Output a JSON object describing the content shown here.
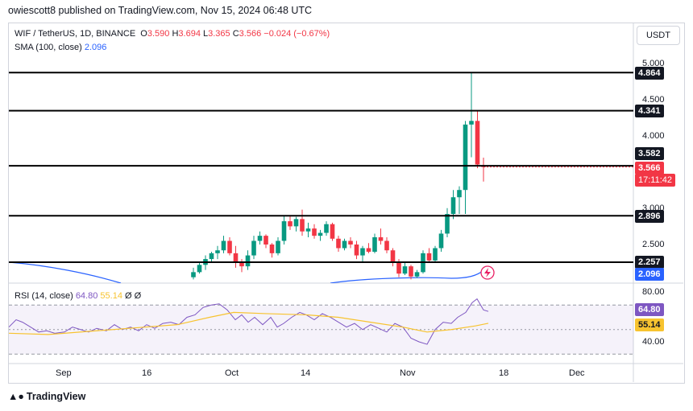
{
  "publisher": {
    "text": "owiescott8 published on TradingView.com, Nov 15, 2024 06:48 UTC"
  },
  "header": {
    "symbol": "WIF / TetherUS, 1D, BINANCE",
    "o_label": "O",
    "o_value": "3.590",
    "h_label": "H",
    "h_value": "3.694",
    "l_label": "L",
    "l_value": "3.365",
    "c_label": "C",
    "c_value": "3.566",
    "change": "−0.024 (−0.67%)",
    "sma_label": "SMA (100, close)",
    "sma_value": "2.096",
    "currency_button": "USDT"
  },
  "price_axis": {
    "ticks": [
      "5.000",
      "4.500",
      "4.000",
      "3.000",
      "2.500"
    ],
    "tags": {
      "line1": "4.864",
      "line2": "4.341",
      "line3": "3.582",
      "last_price": "3.566",
      "countdown": "17:11:42",
      "line4": "2.896",
      "line5": "2.257",
      "sma": "2.096"
    }
  },
  "rsi": {
    "label": "RSI (14, close)",
    "value": "64.80",
    "ma_value": "55.14",
    "extra1": "Ø",
    "extra2": "Ø",
    "axis_ticks": [
      "80.00",
      "40.00"
    ],
    "tags": {
      "rsi": "64.80",
      "ma": "55.14"
    }
  },
  "time_axis": {
    "labels": [
      "Sep",
      "16",
      "Oct",
      "14",
      "Nov",
      "18",
      "Dec"
    ]
  },
  "footer": {
    "brand": "TradingView"
  },
  "colors": {
    "up": "#089981",
    "down": "#f23645",
    "sma": "#2962ff",
    "rsi": "#7e57c2",
    "rsi_ma": "#f7c32f",
    "level_line": "#000000"
  },
  "chart_data": {
    "type": "candlestick",
    "title": "WIF / TetherUS, 1D, BINANCE",
    "levels": [
      4.864,
      4.341,
      3.582,
      2.896,
      2.257
    ],
    "candles": [
      {
        "o": 2.05,
        "h": 2.18,
        "l": 2.02,
        "c": 2.12
      },
      {
        "o": 2.12,
        "h": 2.26,
        "l": 2.1,
        "c": 2.22
      },
      {
        "o": 2.22,
        "h": 2.35,
        "l": 2.15,
        "c": 2.3
      },
      {
        "o": 2.3,
        "h": 2.4,
        "l": 2.25,
        "c": 2.38
      },
      {
        "o": 2.38,
        "h": 2.48,
        "l": 2.3,
        "c": 2.42
      },
      {
        "o": 2.42,
        "h": 2.62,
        "l": 2.38,
        "c": 2.55
      },
      {
        "o": 2.55,
        "h": 2.6,
        "l": 2.35,
        "c": 2.38
      },
      {
        "o": 2.38,
        "h": 2.48,
        "l": 2.18,
        "c": 2.25
      },
      {
        "o": 2.25,
        "h": 2.3,
        "l": 2.12,
        "c": 2.2
      },
      {
        "o": 2.2,
        "h": 2.42,
        "l": 2.15,
        "c": 2.35
      },
      {
        "o": 2.35,
        "h": 2.62,
        "l": 2.3,
        "c": 2.55
      },
      {
        "o": 2.55,
        "h": 2.68,
        "l": 2.5,
        "c": 2.62
      },
      {
        "o": 2.62,
        "h": 2.64,
        "l": 2.45,
        "c": 2.5
      },
      {
        "o": 2.5,
        "h": 2.52,
        "l": 2.32,
        "c": 2.38
      },
      {
        "o": 2.38,
        "h": 2.6,
        "l": 2.35,
        "c": 2.55
      },
      {
        "o": 2.55,
        "h": 2.9,
        "l": 2.5,
        "c": 2.82
      },
      {
        "o": 2.82,
        "h": 2.9,
        "l": 2.7,
        "c": 2.75
      },
      {
        "o": 2.75,
        "h": 2.88,
        "l": 2.68,
        "c": 2.85
      },
      {
        "o": 2.85,
        "h": 2.98,
        "l": 2.62,
        "c": 2.68
      },
      {
        "o": 2.68,
        "h": 2.8,
        "l": 2.6,
        "c": 2.72
      },
      {
        "o": 2.72,
        "h": 2.78,
        "l": 2.58,
        "c": 2.62
      },
      {
        "o": 2.62,
        "h": 2.7,
        "l": 2.55,
        "c": 2.66
      },
      {
        "o": 2.66,
        "h": 2.82,
        "l": 2.62,
        "c": 2.78
      },
      {
        "o": 2.78,
        "h": 2.8,
        "l": 2.55,
        "c": 2.58
      },
      {
        "o": 2.58,
        "h": 2.62,
        "l": 2.4,
        "c": 2.45
      },
      {
        "o": 2.45,
        "h": 2.58,
        "l": 2.42,
        "c": 2.55
      },
      {
        "o": 2.55,
        "h": 2.6,
        "l": 2.45,
        "c": 2.5
      },
      {
        "o": 2.5,
        "h": 2.55,
        "l": 2.3,
        "c": 2.35
      },
      {
        "o": 2.35,
        "h": 2.48,
        "l": 2.25,
        "c": 2.45
      },
      {
        "o": 2.45,
        "h": 2.52,
        "l": 2.38,
        "c": 2.4
      },
      {
        "o": 2.4,
        "h": 2.65,
        "l": 2.38,
        "c": 2.6
      },
      {
        "o": 2.6,
        "h": 2.72,
        "l": 2.5,
        "c": 2.55
      },
      {
        "o": 2.55,
        "h": 2.6,
        "l": 2.38,
        "c": 2.42
      },
      {
        "o": 2.42,
        "h": 2.45,
        "l": 2.2,
        "c": 2.25
      },
      {
        "o": 2.25,
        "h": 2.3,
        "l": 2.05,
        "c": 2.1
      },
      {
        "o": 2.1,
        "h": 2.25,
        "l": 2.08,
        "c": 2.2
      },
      {
        "o": 2.2,
        "h": 2.22,
        "l": 2.02,
        "c": 2.06
      },
      {
        "o": 2.06,
        "h": 2.15,
        "l": 2.04,
        "c": 2.12
      },
      {
        "o": 2.12,
        "h": 2.42,
        "l": 2.1,
        "c": 2.38
      },
      {
        "o": 2.38,
        "h": 2.45,
        "l": 2.25,
        "c": 2.28
      },
      {
        "o": 2.28,
        "h": 2.48,
        "l": 2.25,
        "c": 2.45
      },
      {
        "o": 2.45,
        "h": 2.7,
        "l": 2.4,
        "c": 2.65
      },
      {
        "o": 2.65,
        "h": 3.0,
        "l": 2.6,
        "c": 2.92
      },
      {
        "o": 2.92,
        "h": 3.25,
        "l": 2.85,
        "c": 3.15
      },
      {
        "o": 3.15,
        "h": 3.3,
        "l": 2.92,
        "c": 3.25
      },
      {
        "o": 3.25,
        "h": 4.2,
        "l": 2.92,
        "c": 4.15
      },
      {
        "o": 4.15,
        "h": 4.864,
        "l": 3.7,
        "c": 4.2
      },
      {
        "o": 4.2,
        "h": 4.341,
        "l": 3.55,
        "c": 3.6
      },
      {
        "o": 3.59,
        "h": 3.694,
        "l": 3.365,
        "c": 3.566
      }
    ],
    "sma": {
      "name": "SMA (100, close)",
      "last": 2.096
    },
    "rsi": {
      "name": "RSI (14, close)",
      "last": 64.8,
      "ma_last": 55.14,
      "ylim": [
        30,
        80
      ]
    }
  }
}
